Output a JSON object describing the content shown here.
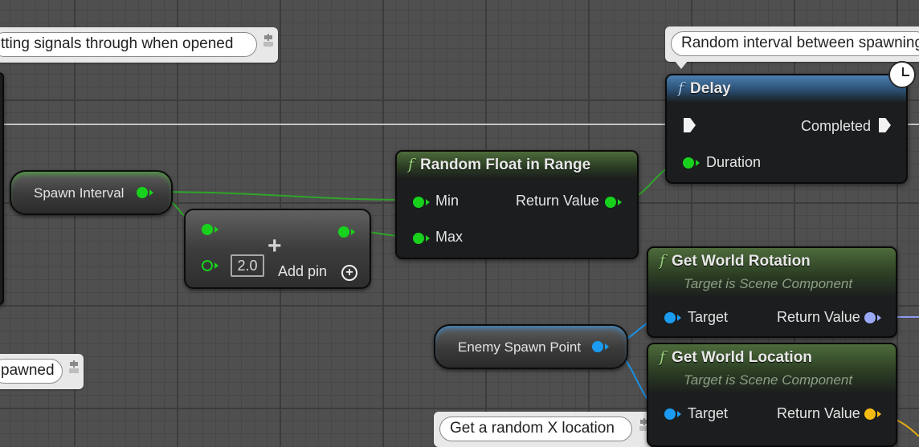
{
  "comments": {
    "top_left": "tting signals through when opened",
    "top_right": "Random interval between spawning",
    "bottom_left": "pawned",
    "bottom_mid": "Get a random X location"
  },
  "variables": {
    "spawn_interval": "Spawn Interval",
    "enemy_spawn_point": "Enemy Spawn Point"
  },
  "add_node": {
    "value": "2.0",
    "add_pin_label": "Add pin",
    "plus_symbol": "+"
  },
  "random_float": {
    "title": "Random Float in Range",
    "icon": "f",
    "inputs": [
      "Min",
      "Max"
    ],
    "output": "Return Value"
  },
  "delay": {
    "title": "Delay",
    "icon": "f",
    "output_exec": "Completed",
    "input": "Duration"
  },
  "get_world_rotation": {
    "title": "Get World Rotation",
    "icon": "f",
    "subtitle": "Target is Scene Component",
    "input": "Target",
    "output": "Return Value"
  },
  "get_world_location": {
    "title": "Get World Location",
    "icon": "f",
    "subtitle": "Target is Scene Component",
    "input": "Target",
    "output": "Return Value"
  },
  "colors": {
    "float_pin": "#18d11c",
    "object_pin": "#1b9cf2",
    "rotator_pin": "#9aa9f5",
    "vector_pin": "#f5bb15",
    "exec_wire": "#e6e6e6"
  }
}
